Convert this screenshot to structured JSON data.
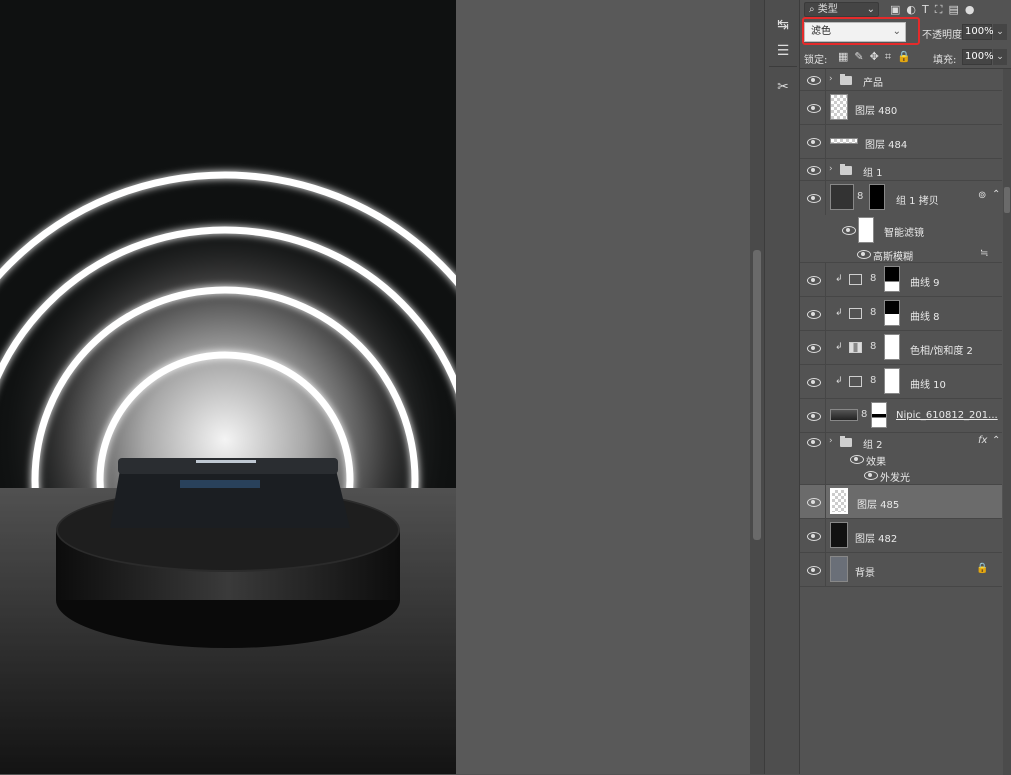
{
  "layers_panel": {
    "filter_kind": "类型",
    "blend_mode": "滤色",
    "opacity_label": "不透明度:",
    "opacity_value": "100%",
    "lock_label": "锁定:",
    "fill_label": "填充:",
    "fill_value": "100%",
    "layers": [
      {
        "name": "产品",
        "type": "group"
      },
      {
        "name": "图层 480",
        "type": "pixel"
      },
      {
        "name": "图层 484",
        "type": "pixel"
      },
      {
        "name": "组 1",
        "type": "group"
      },
      {
        "name": "组 1 拷贝",
        "type": "smart-object"
      },
      {
        "name": "智能滤镜",
        "type": "smart-filter"
      },
      {
        "name": "高斯模糊",
        "type": "filter"
      },
      {
        "name": "曲线 9",
        "type": "adjustment"
      },
      {
        "name": "曲线 8",
        "type": "adjustment"
      },
      {
        "name": "色相/饱和度 2",
        "type": "adjustment"
      },
      {
        "name": "曲线 10",
        "type": "adjustment"
      },
      {
        "name": "Nipic_610812_201...",
        "type": "pixel"
      },
      {
        "name": "组 2",
        "type": "group"
      },
      {
        "name": "效果",
        "type": "effects"
      },
      {
        "name": "外发光",
        "type": "effect"
      },
      {
        "name": "图层 485",
        "type": "pixel",
        "selected": true
      },
      {
        "name": "图层 482",
        "type": "pixel"
      },
      {
        "name": "背景",
        "type": "background"
      }
    ],
    "fx_label": "fx"
  },
  "colors": {
    "highlight": "#e52b2b",
    "selected_row": "#6b6b6b"
  }
}
